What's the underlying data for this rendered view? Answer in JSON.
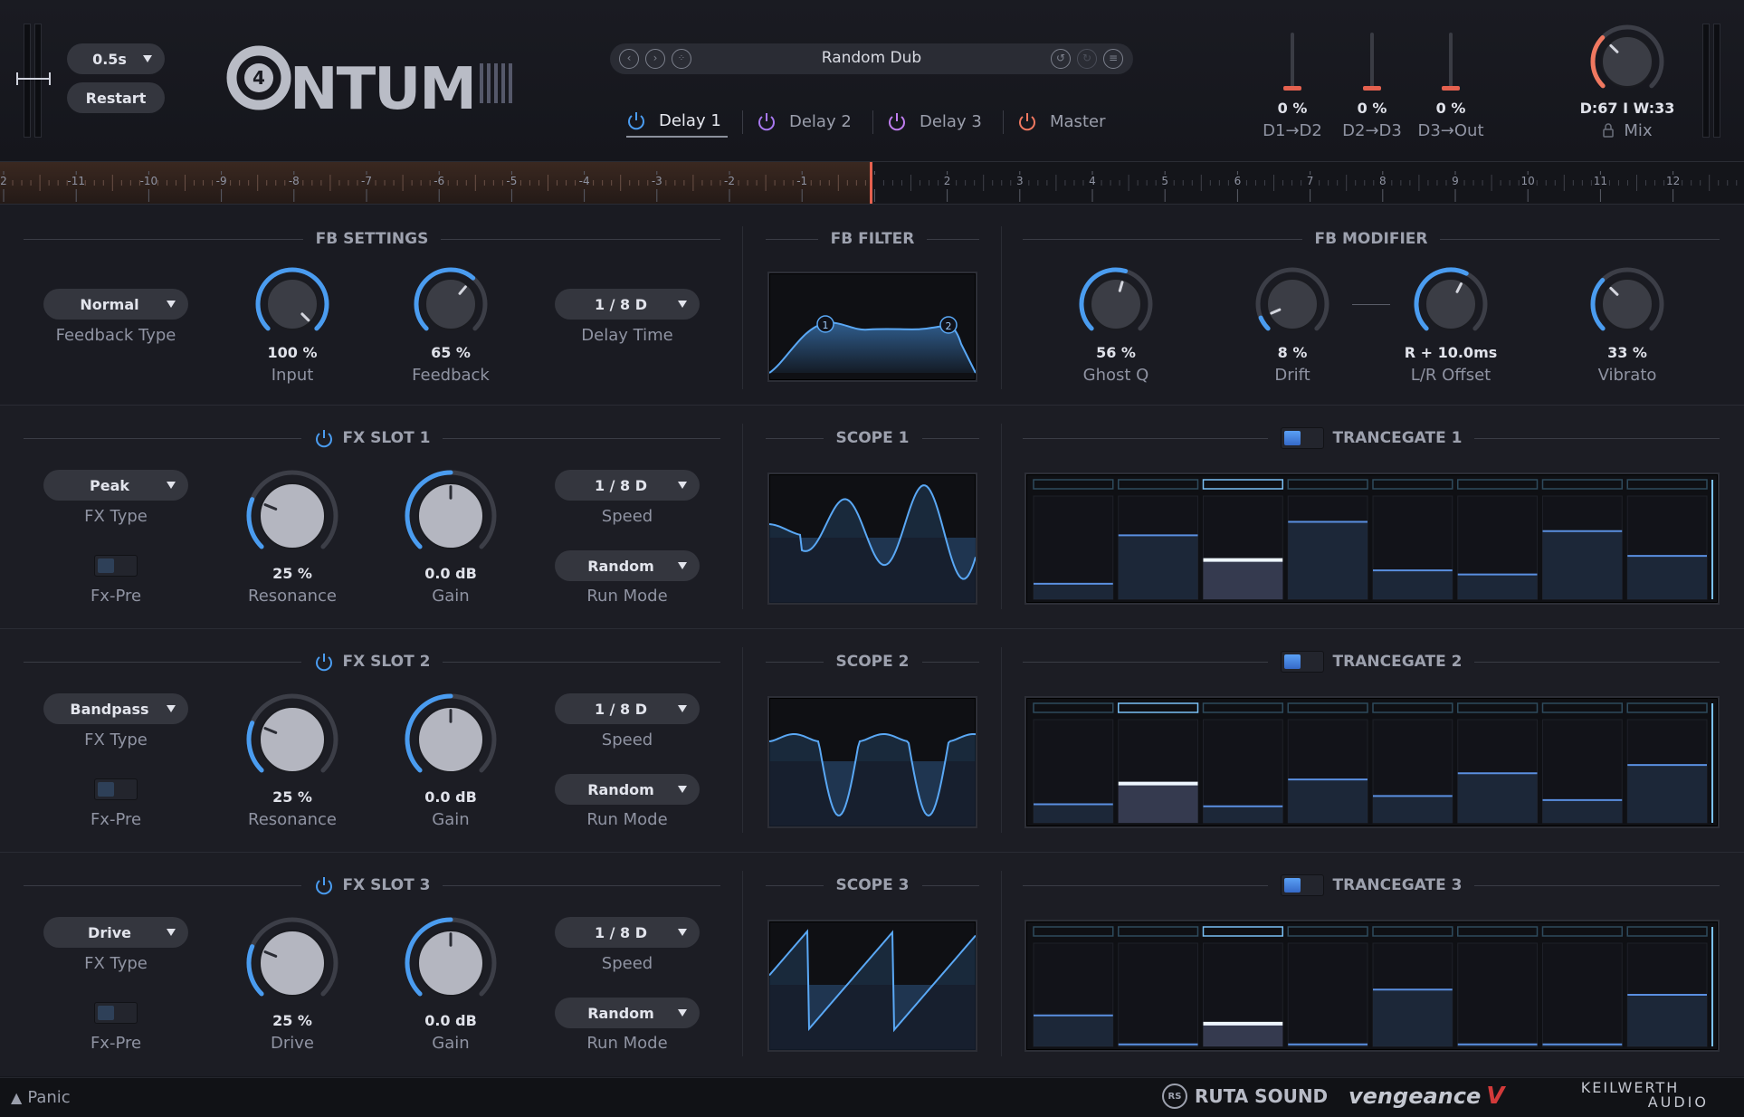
{
  "header": {
    "time_select": "0.5s",
    "restart_label": "Restart",
    "logo_text": "4NTUM",
    "preset_name": "Random Dub",
    "tabs": [
      {
        "label": "Delay 1",
        "color": "#4a9cf0",
        "active": true
      },
      {
        "label": "Delay 2",
        "color": "#a878f0",
        "active": false
      },
      {
        "label": "Delay 3",
        "color": "#c07ef0",
        "active": false
      },
      {
        "label": "Master",
        "color": "#f07860",
        "active": false
      }
    ],
    "routing": [
      {
        "value": "0 %",
        "label": "D1→D2"
      },
      {
        "value": "0 %",
        "label": "D2→D3"
      },
      {
        "value": "0 %",
        "label": "D3→Out"
      }
    ],
    "mix": {
      "readout": "D:67 I W:33",
      "label": "Mix",
      "level": 0.33
    }
  },
  "timeline": {
    "ticks": [
      "2",
      "-11",
      "-10",
      "-9",
      "-8",
      "-7",
      "-6",
      "-5",
      "-4",
      "-3",
      "-2",
      "-1",
      "",
      "2",
      "3",
      "4",
      "5",
      "6",
      "7",
      "8",
      "9",
      "10",
      "11",
      "12"
    ]
  },
  "fb_settings": {
    "title": "FB SETTINGS",
    "feedback_type": "Normal",
    "feedback_type_label": "Feedback Type",
    "input": {
      "value": "100 %",
      "label": "Input",
      "level": 1.0
    },
    "feedback": {
      "value": "65 %",
      "label": "Feedback",
      "level": 0.65
    },
    "delay_time": "1 / 8 D",
    "delay_time_label": "Delay Time"
  },
  "fb_filter": {
    "title": "FB FILTER",
    "node1": "1",
    "node2": "2"
  },
  "fb_modifier": {
    "title": "FB MODIFIER",
    "ghost_q": {
      "value": "56 %",
      "label": "Ghost Q",
      "level": 0.56
    },
    "drift": {
      "value": "8 %",
      "label": "Drift",
      "level": 0.08
    },
    "lr_offset": {
      "value": "R + 10.0ms",
      "label": "L/R Offset",
      "level": 0.6
    },
    "vibrato": {
      "value": "33 %",
      "label": "Vibrato",
      "level": 0.33
    }
  },
  "slots": [
    {
      "title": "FX SLOT 1",
      "fx_type": "Peak",
      "fx_type_label": "FX Type",
      "fx_pre_label": "Fx-Pre",
      "knob1": {
        "value": "25 %",
        "label": "Resonance",
        "level": 0.25
      },
      "knob2": {
        "value": "0.0 dB",
        "label": "Gain",
        "level": 0.5
      },
      "speed": "1 / 8 D",
      "speed_label": "Speed",
      "run_mode": "Random",
      "run_mode_label": "Run Mode",
      "scope_title": "SCOPE 1",
      "gate_title": "TRANCEGATE 1",
      "gate_steps": [
        0.15,
        0.62,
        0.38,
        0.75,
        0.28,
        0.24,
        0.66,
        0.42
      ],
      "gate_active": 2
    },
    {
      "title": "FX SLOT 2",
      "fx_type": "Bandpass",
      "fx_type_label": "FX Type",
      "fx_pre_label": "Fx-Pre",
      "knob1": {
        "value": "25 %",
        "label": "Resonance",
        "level": 0.25
      },
      "knob2": {
        "value": "0.0 dB",
        "label": "Gain",
        "level": 0.5
      },
      "speed": "1 / 8 D",
      "speed_label": "Speed",
      "run_mode": "Random",
      "run_mode_label": "Run Mode",
      "scope_title": "SCOPE 2",
      "gate_title": "TRANCEGATE 2",
      "gate_steps": [
        0.18,
        0.38,
        0.16,
        0.42,
        0.26,
        0.48,
        0.22,
        0.56
      ],
      "gate_active": 1
    },
    {
      "title": "FX SLOT 3",
      "fx_type": "Drive",
      "fx_type_label": "FX Type",
      "fx_pre_label": "Fx-Pre",
      "knob1": {
        "value": "25 %",
        "label": "Drive",
        "level": 0.25
      },
      "knob2": {
        "value": "0.0 dB",
        "label": "Gain",
        "level": 0.5
      },
      "speed": "1 / 8 D",
      "speed_label": "Speed",
      "run_mode": "Random",
      "run_mode_label": "Run Mode",
      "scope_title": "SCOPE 3",
      "gate_title": "TRANCEGATE 3",
      "gate_steps": [
        0.3,
        0.02,
        0.22,
        0.02,
        0.55,
        0.02,
        0.02,
        0.5
      ],
      "gate_active": 2
    }
  ],
  "footer": {
    "panic_label": "Panic",
    "brand1": "RUTA SOUND",
    "brand2": "vengeance",
    "brand3a": "KEILWERTH",
    "brand3b": "AUDIO"
  },
  "colors": {
    "accent": "#4a9cf0",
    "bg": "#16171d",
    "panel": "#1b1c23",
    "playhead": "#e5614f"
  }
}
